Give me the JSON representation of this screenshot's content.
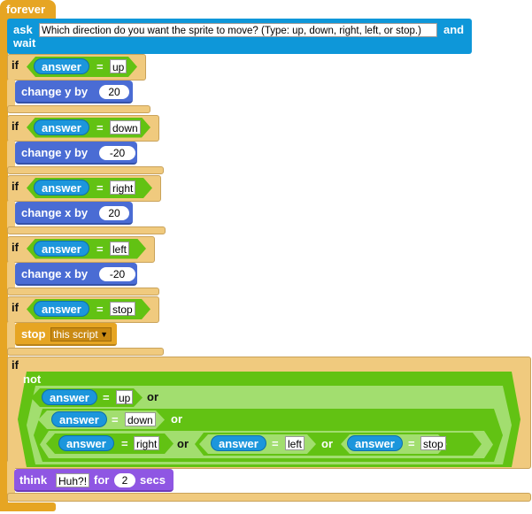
{
  "forever": {
    "label": "forever"
  },
  "ask": {
    "label": "ask",
    "question": "Which direction do you want the sprite to move? (Type: up, down, right, left, or stop.)",
    "and": "and",
    "wait": "wait"
  },
  "if_label": "if",
  "answer": "answer",
  "eq": "=",
  "or": "or",
  "not": "not",
  "branches": [
    {
      "value": "up",
      "action": "change y by",
      "amount": "20"
    },
    {
      "value": "down",
      "action": "change y by",
      "amount": "-20"
    },
    {
      "value": "right",
      "action": "change x by",
      "amount": "20"
    },
    {
      "value": "left",
      "action": "change x by",
      "amount": "-20"
    },
    {
      "value": "stop",
      "action": "stop",
      "option": "this script"
    }
  ],
  "last_if": {
    "values": [
      "up",
      "down",
      "right",
      "left",
      "stop"
    ],
    "think": "think",
    "message": "Huh?!",
    "for": "for",
    "secs_value": "2",
    "secs": "secs"
  },
  "colors": {
    "control": "#F0CA7E",
    "forever": "#E6A523",
    "sensing": "#1C96DC",
    "motion": "#4A6CD4",
    "operators": "#62C213",
    "looks": "#8F56E3"
  }
}
